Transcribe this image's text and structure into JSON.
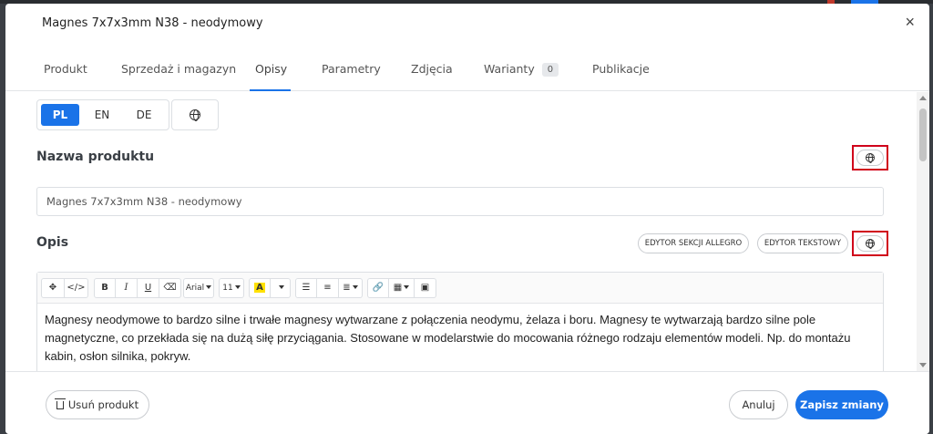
{
  "modal": {
    "title": "Magnes 7x7x3mm N38 - neodymowy",
    "close_label": "×"
  },
  "tabs": [
    {
      "label": "Produkt"
    },
    {
      "label": "Sprzedaż i magazyn"
    },
    {
      "label": "Opisy",
      "active": true
    },
    {
      "label": "Parametry"
    },
    {
      "label": "Zdjęcia"
    },
    {
      "label": "Warianty",
      "badge": "0"
    },
    {
      "label": "Publikacje"
    }
  ],
  "languages": {
    "items": [
      "PL",
      "EN",
      "DE"
    ],
    "active": "PL"
  },
  "product_name": {
    "label": "Nazwa produktu",
    "value": "Magnes 7x7x3mm N38 - neodymowy"
  },
  "description": {
    "label": "Opis",
    "allegro_editor_button": "EDYTOR SEKCJI ALLEGRO",
    "text_editor_button": "EDYTOR TEKSTOWY",
    "toolbar": {
      "bold": "B",
      "italic": "I",
      "underline": "U",
      "font_family": "Arial",
      "font_size": "11",
      "color_a": "A"
    },
    "text": "Magnesy neodymowe to bardzo silne i trwałe magnesy wytwarzane z połączenia neodymu, żelaza i boru. Magnesy te wytwarzają bardzo silne pole magnetyczne, co przekłada się na dużą siłę przyciągania. Stosowane w modelarstwie do mocowania różnego rodzaju elementów modeli. Np. do montażu kabin, osłon silnika, pokryw."
  },
  "footer": {
    "delete_label": "Usuń produkt",
    "cancel_label": "Anuluj",
    "save_label": "Zapisz zmiany"
  },
  "colors": {
    "accent": "#1a73e8",
    "highlight_box": "#d0021b"
  }
}
